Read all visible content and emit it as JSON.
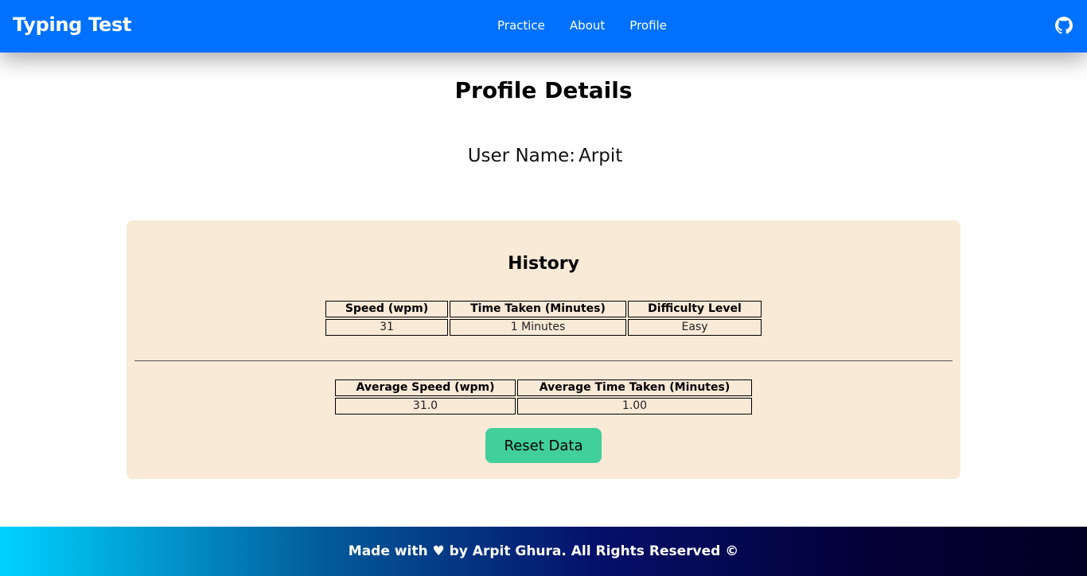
{
  "navbar": {
    "brand": "Typing Test",
    "links": [
      "Practice",
      "About",
      "Profile"
    ],
    "github_icon": "github-icon"
  },
  "profile": {
    "title": "Profile Details",
    "username_label": "User Name:",
    "username": "Arpit"
  },
  "history": {
    "title": "History",
    "columns": [
      "Speed (wpm)",
      "Time Taken (Minutes)",
      "Difficulty Level"
    ],
    "rows": [
      [
        "31",
        "1 Minutes",
        "Easy"
      ]
    ]
  },
  "averages": {
    "columns": [
      "Average Speed (wpm)",
      "Average Time Taken (Minutes)"
    ],
    "values": [
      "31.0",
      "1.00"
    ]
  },
  "reset_button": "Reset Data",
  "footer": {
    "text": "Made with ♥ by Arpit Ghura. All Rights Reserved ©"
  },
  "colors": {
    "navbar": "#0071fe",
    "card": "#f9e9d7",
    "button": "#41cf9c"
  }
}
